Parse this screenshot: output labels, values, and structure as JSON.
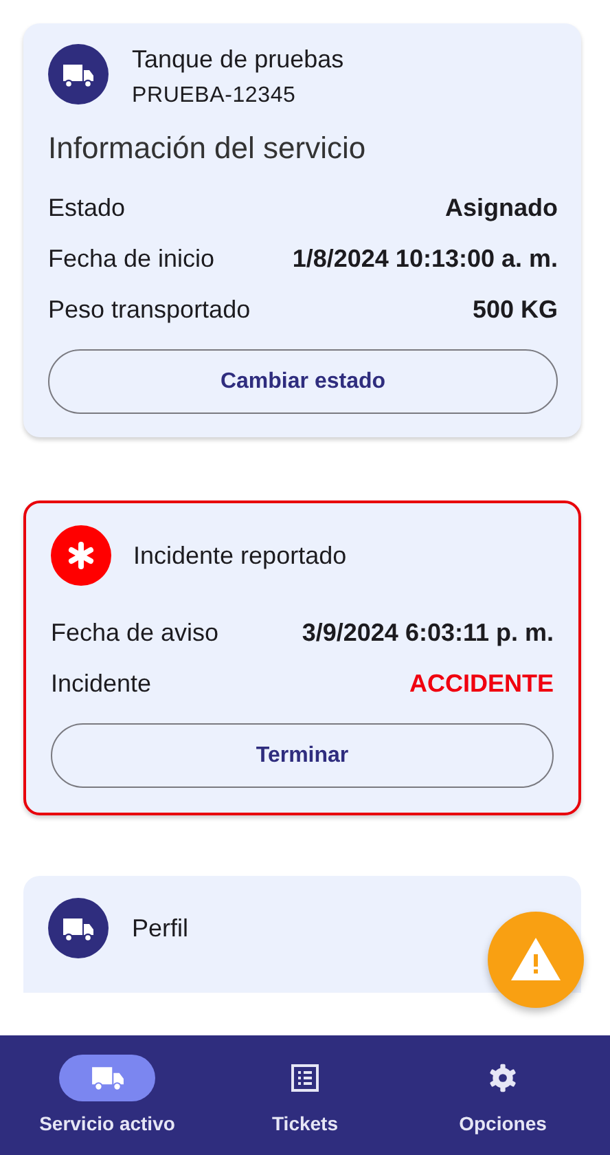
{
  "service_card": {
    "title": "Tanque de pruebas",
    "subtitle": "PRUEBA-12345",
    "section_title": "Información del servicio",
    "rows": [
      {
        "label": "Estado",
        "value": "Asignado"
      },
      {
        "label": "Fecha de inicio",
        "value": "1/8/2024 10:13:00 a. m."
      },
      {
        "label": "Peso transportado",
        "value": "500 KG"
      }
    ],
    "button": "Cambiar estado"
  },
  "incident_card": {
    "title": "Incidente reportado",
    "rows": [
      {
        "label": "Fecha de aviso",
        "value": "3/9/2024 6:03:11 p. m.",
        "alert": false
      },
      {
        "label": "Incidente",
        "value": "ACCIDENTE",
        "alert": true
      }
    ],
    "button": "Terminar"
  },
  "profile_card": {
    "title": "Perfil"
  },
  "bottom_nav": [
    {
      "label": "Servicio activo",
      "selected": true
    },
    {
      "label": "Tickets",
      "selected": false
    },
    {
      "label": "Opciones",
      "selected": false
    }
  ]
}
